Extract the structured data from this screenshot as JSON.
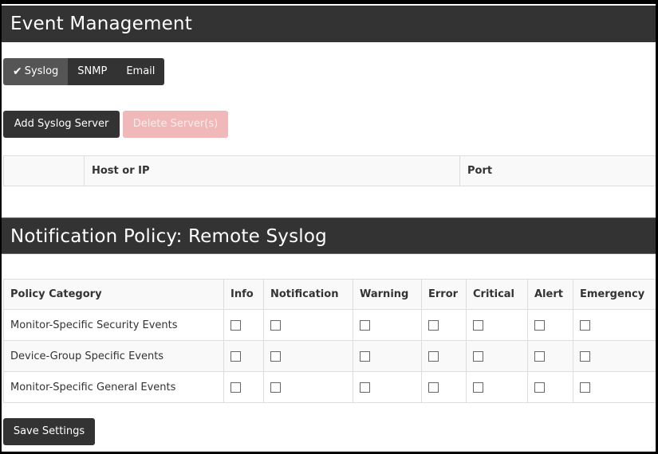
{
  "event_header": {
    "title": "Event Management"
  },
  "tabs": [
    {
      "label": "Syslog",
      "active": true,
      "icon": "check-icon"
    },
    {
      "label": "SNMP",
      "active": false
    },
    {
      "label": "Email",
      "active": false
    }
  ],
  "toolbar": {
    "add_label": "Add Syslog Server",
    "delete_label": "Delete Server(s)",
    "delete_disabled": true
  },
  "server_table": {
    "columns": [
      "",
      "Host or IP",
      "Port"
    ],
    "rows": []
  },
  "policy_header": {
    "title": "Notification Policy: Remote Syslog"
  },
  "policy_table": {
    "columns": [
      "Policy Category",
      "Info",
      "Notification",
      "Warning",
      "Error",
      "Critical",
      "Alert",
      "Emergency"
    ],
    "rows": [
      {
        "category": "Monitor-Specific Security Events",
        "checks": [
          false,
          false,
          false,
          false,
          false,
          false,
          false
        ]
      },
      {
        "category": "Device-Group Specific Events",
        "checks": [
          false,
          false,
          false,
          false,
          false,
          false,
          false
        ]
      },
      {
        "category": "Monitor-Specific General Events",
        "checks": [
          false,
          false,
          false,
          false,
          false,
          false,
          false
        ]
      }
    ]
  },
  "footer": {
    "save_label": "Save Settings"
  },
  "colors": {
    "header_bg": "#333333",
    "active_tab": "#555555",
    "delete_disabled_bg": "#f0b8b8"
  }
}
